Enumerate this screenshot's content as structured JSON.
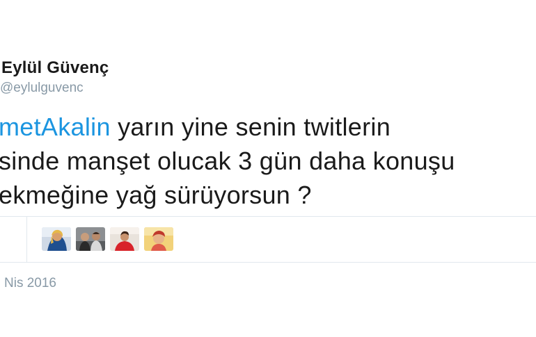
{
  "tweet": {
    "display_name": "Eylül Güvenç",
    "handle": "@eylulguvenc",
    "text_lines": [
      {
        "mention": "metAkalin",
        "rest": " yarın yine senin twitlerin"
      },
      {
        "mention": "",
        "rest": "sinde manşet olucak 3 gün daha konuşu"
      },
      {
        "mention": "",
        "rest": "ekmeğine yağ sürüyorsun ?"
      }
    ],
    "date": "Nis 2016"
  },
  "likers": [
    {
      "icon": "avatar-1"
    },
    {
      "icon": "avatar-2"
    },
    {
      "icon": "avatar-3"
    },
    {
      "icon": "avatar-4"
    }
  ],
  "colors": {
    "mention": "#1b95e0",
    "text": "#1a1a1a",
    "muted": "#8899a6",
    "divider": "#e1e8ed"
  }
}
